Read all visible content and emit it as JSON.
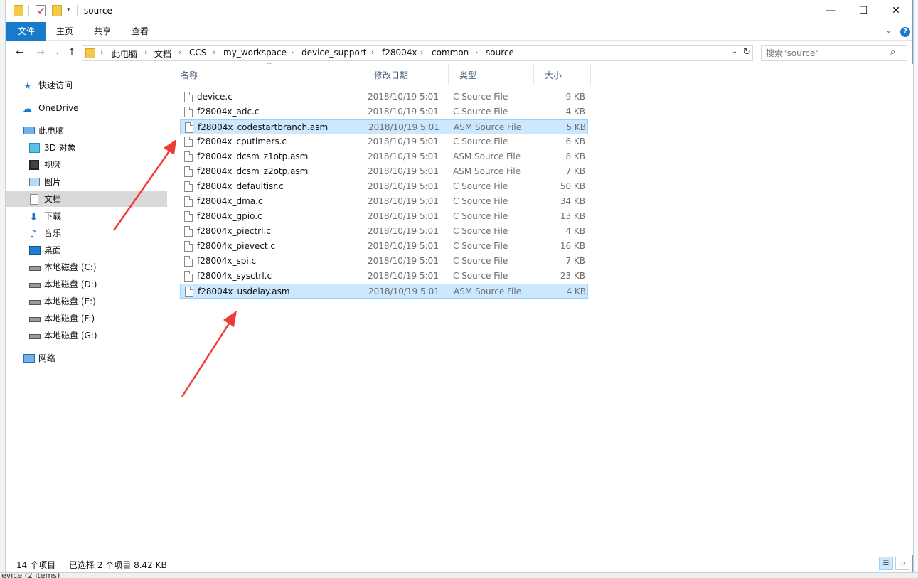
{
  "window": {
    "title": "source"
  },
  "ribbon": {
    "tabs": [
      "文件",
      "主页",
      "共享",
      "查看"
    ]
  },
  "address": {
    "crumbs": [
      "此电脑",
      "文档",
      "CCS",
      "my_workspace",
      "device_support",
      "f28004x",
      "common",
      "source"
    ]
  },
  "search": {
    "placeholder": "搜索\"source\""
  },
  "sidebar": {
    "items": [
      {
        "label": "快速访问",
        "icon": "star-icon"
      },
      {
        "label": "OneDrive",
        "icon": "cloud-icon"
      },
      {
        "label": "此电脑",
        "icon": "computer-icon"
      },
      {
        "label": "3D 对象",
        "icon": "cube-icon"
      },
      {
        "label": "视频",
        "icon": "video-icon"
      },
      {
        "label": "图片",
        "icon": "picture-icon"
      },
      {
        "label": "文档",
        "icon": "document-icon",
        "selected": true
      },
      {
        "label": "下载",
        "icon": "download-icon"
      },
      {
        "label": "音乐",
        "icon": "music-icon"
      },
      {
        "label": "桌面",
        "icon": "desktop-icon"
      },
      {
        "label": "本地磁盘 (C:)",
        "icon": "drive-icon"
      },
      {
        "label": "本地磁盘 (D:)",
        "icon": "drive-icon"
      },
      {
        "label": "本地磁盘 (E:)",
        "icon": "drive-icon"
      },
      {
        "label": "本地磁盘 (F:)",
        "icon": "drive-icon"
      },
      {
        "label": "本地磁盘 (G:)",
        "icon": "drive-icon"
      },
      {
        "label": "网络",
        "icon": "network-icon"
      }
    ]
  },
  "columns": [
    "名称",
    "修改日期",
    "类型",
    "大小"
  ],
  "files": [
    {
      "name": "device.c",
      "date": "2018/10/19 5:01",
      "type": "C Source File",
      "size": "9 KB",
      "selected": false
    },
    {
      "name": "f28004x_adc.c",
      "date": "2018/10/19 5:01",
      "type": "C Source File",
      "size": "4 KB",
      "selected": false
    },
    {
      "name": "f28004x_codestartbranch.asm",
      "date": "2018/10/19 5:01",
      "type": "ASM Source File",
      "size": "5 KB",
      "selected": true
    },
    {
      "name": "f28004x_cputimers.c",
      "date": "2018/10/19 5:01",
      "type": "C Source File",
      "size": "6 KB",
      "selected": false
    },
    {
      "name": "f28004x_dcsm_z1otp.asm",
      "date": "2018/10/19 5:01",
      "type": "ASM Source File",
      "size": "8 KB",
      "selected": false
    },
    {
      "name": "f28004x_dcsm_z2otp.asm",
      "date": "2018/10/19 5:01",
      "type": "ASM Source File",
      "size": "7 KB",
      "selected": false
    },
    {
      "name": "f28004x_defaultisr.c",
      "date": "2018/10/19 5:01",
      "type": "C Source File",
      "size": "50 KB",
      "selected": false
    },
    {
      "name": "f28004x_dma.c",
      "date": "2018/10/19 5:01",
      "type": "C Source File",
      "size": "34 KB",
      "selected": false
    },
    {
      "name": "f28004x_gpio.c",
      "date": "2018/10/19 5:01",
      "type": "C Source File",
      "size": "13 KB",
      "selected": false
    },
    {
      "name": "f28004x_piectrl.c",
      "date": "2018/10/19 5:01",
      "type": "C Source File",
      "size": "4 KB",
      "selected": false
    },
    {
      "name": "f28004x_pievect.c",
      "date": "2018/10/19 5:01",
      "type": "C Source File",
      "size": "16 KB",
      "selected": false
    },
    {
      "name": "f28004x_spi.c",
      "date": "2018/10/19 5:01",
      "type": "C Source File",
      "size": "7 KB",
      "selected": false
    },
    {
      "name": "f28004x_sysctrl.c",
      "date": "2018/10/19 5:01",
      "type": "C Source File",
      "size": "23 KB",
      "selected": false
    },
    {
      "name": "f28004x_usdelay.asm",
      "date": "2018/10/19 5:01",
      "type": "ASM Source File",
      "size": "4 KB",
      "selected": true
    }
  ],
  "status": {
    "count": "14 个项目",
    "selection": "已选择 2 个项目  8.42 KB"
  },
  "background": {
    "bottom_text": "evice (2 items)"
  },
  "colors": {
    "accent": "#1979ca",
    "selection": "#cce8ff",
    "selection_border": "#99d1ff",
    "annotation_arrow": "#ef3b36"
  }
}
